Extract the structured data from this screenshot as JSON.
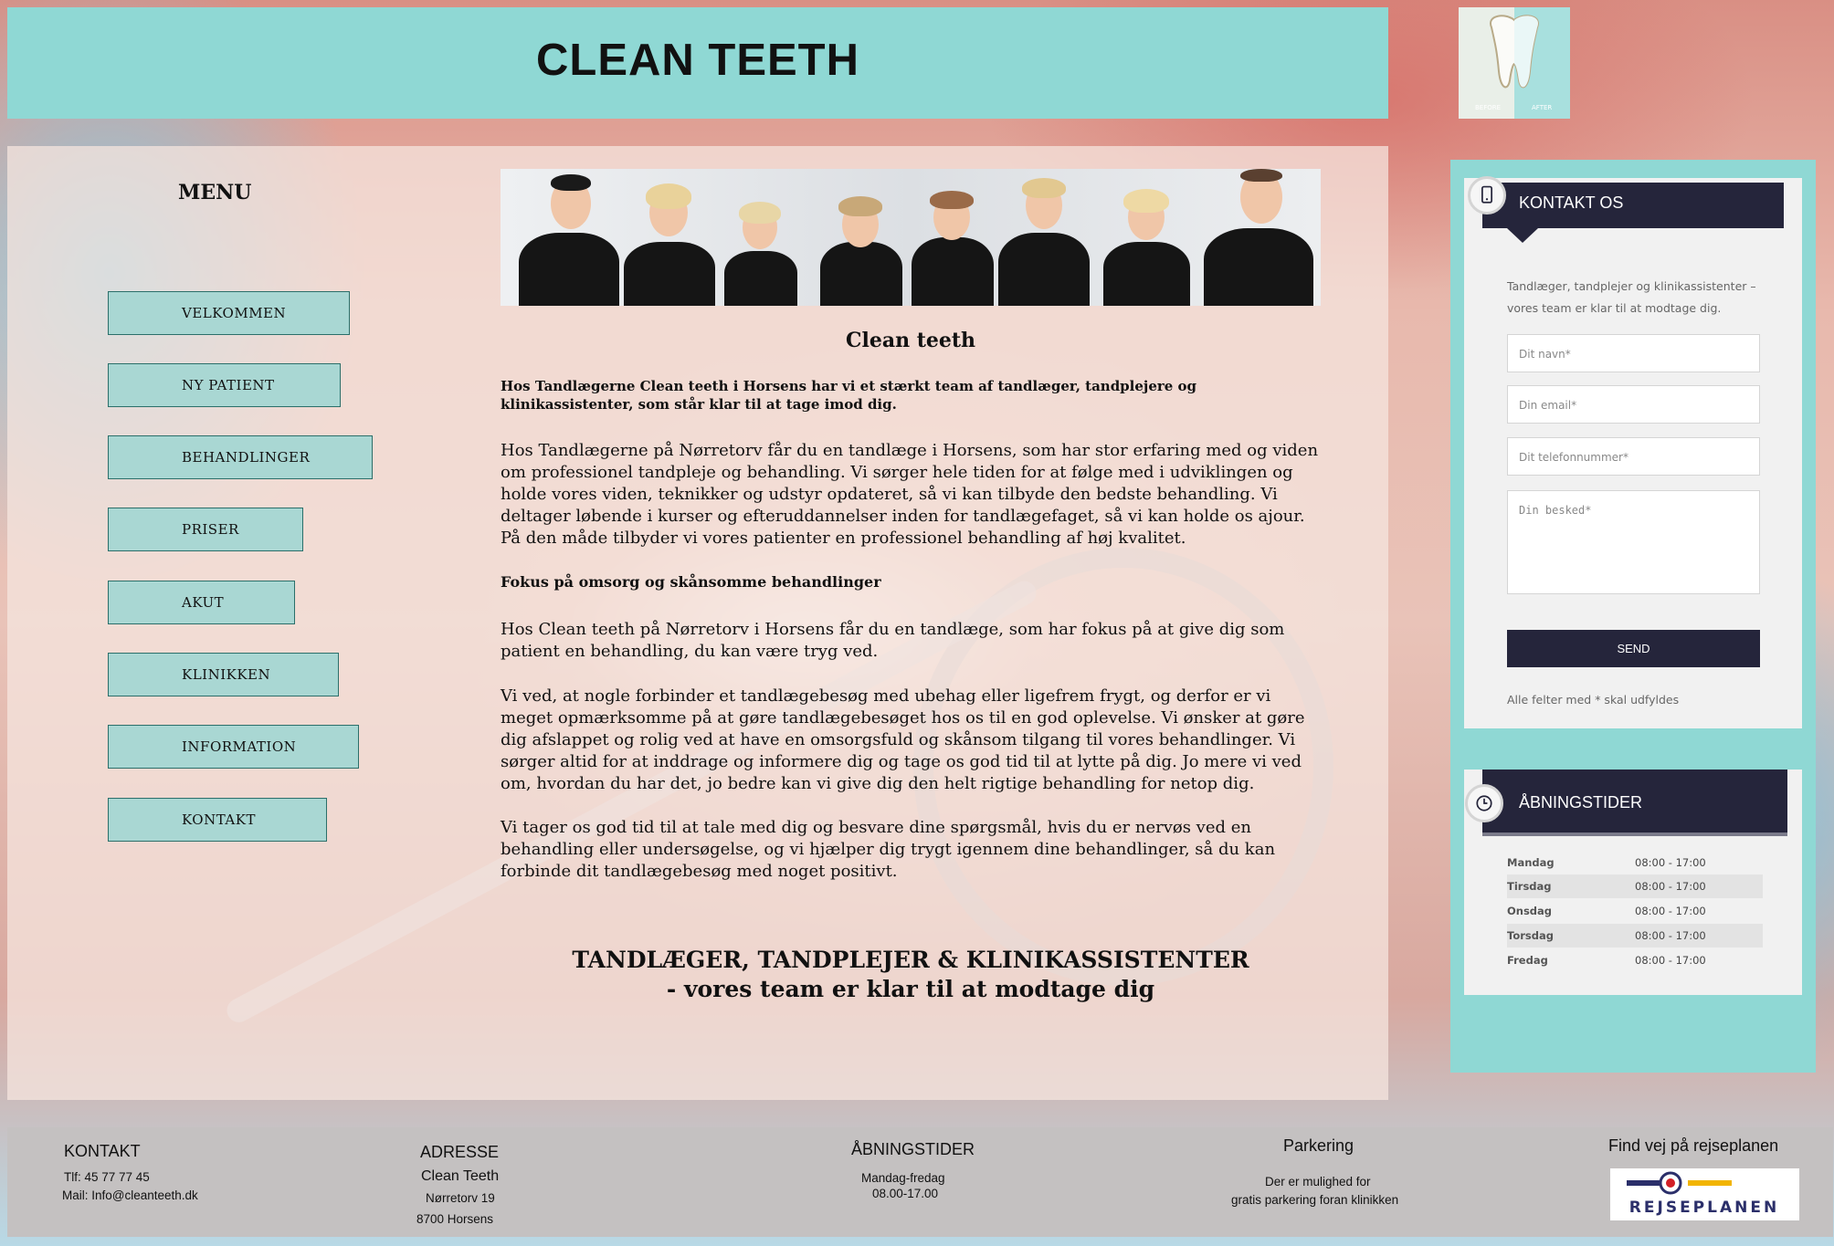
{
  "header": {
    "title": "CLEAN TEETH"
  },
  "logo": {
    "before": "BEFORE",
    "after": "AFTER"
  },
  "menu": {
    "title": "MENU",
    "items": [
      "VELKOMMEN",
      "NY PATIENT",
      "BEHANDLINGER",
      "PRISER",
      "AKUT",
      "KLINIKKEN",
      "INFORMATION",
      "KONTAKT"
    ]
  },
  "content": {
    "title": "Clean teeth",
    "intro": "Hos Tandlægerne Clean teeth i Horsens har vi et stærkt team af tandlæger, tandplejere og klinikassistenter, som står klar til at tage imod dig.",
    "p1": "Hos Tandlægerne på Nørretorv får du en tandlæge i Horsens, som har stor erfaring med og viden om professionel tandpleje og behandling. Vi sørger hele tiden for at følge med i udviklingen og holde vores viden, teknikker og udstyr opdateret, så vi kan tilbyde den bedste behandling. Vi deltager løbende i kurser og efteruddannelser inden for tandlægefaget, så vi kan holde os ajour. På den måde tilbyder vi vores patienter en professionel behandling af høj kvalitet.",
    "subheading": "Fokus på omsorg og skånsomme behandlinger",
    "p2": "Hos Clean teeth på Nørretorv i Horsens får du en tandlæge, som har fokus på at give dig som patient en behandling, du kan være tryg ved.",
    "p3": "Vi ved, at nogle forbinder et tandlægebesøg med ubehag eller ligefrem frygt, og derfor er vi meget opmærksomme på at gøre tandlægebesøget hos os til en god oplevelse. Vi ønsker at gøre dig afslappet og rolig ved at have en omsorgsfuld og skånsom tilgang til vores behandlinger. Vi sørger altid for at inddrage og informere dig og tage os god tid til at lytte på dig. Jo mere vi ved om, hvordan du har det, jo bedre kan vi give dig den helt rigtige behandling for netop dig.",
    "p4": "Vi tager os god tid til at tale med dig og besvare dine spørgsmål, hvis du er nervøs ved en behandling eller undersøgelse, og vi hjælper dig trygt igennem dine behandlinger, så du kan forbinde dit tandlægebesøg med noget positivt.",
    "tagline1": "TANDLÆGER, TANDPLEJER & KLINIKASSISTENTER",
    "tagline2": "- vores team er klar til at modtage dig"
  },
  "contact_widget": {
    "title": "KONTAKT OS",
    "description": "Tandlæger, tandplejer og klinikassistenter – vores team er klar til at modtage dig.",
    "name_placeholder": "Dit navn*",
    "email_placeholder": "Din email*",
    "phone_placeholder": "Dit telefonnummer*",
    "message_placeholder": "Din besked*",
    "send_label": "SEND",
    "required_note": "Alle felter med * skal udfyldes"
  },
  "hours_widget": {
    "title": "ÅBNINGSTIDER",
    "rows": [
      {
        "day": "Mandag",
        "time": "08:00 - 17:00"
      },
      {
        "day": "Tirsdag",
        "time": "08:00 - 17:00"
      },
      {
        "day": "Onsdag",
        "time": "08:00 - 17:00"
      },
      {
        "day": "Torsdag",
        "time": "08:00 - 17:00"
      },
      {
        "day": "Fredag",
        "time": "08:00 - 17:00"
      }
    ]
  },
  "footer": {
    "kontakt": {
      "title": "KONTAKT",
      "phone": "Tlf: 45 77 77 45",
      "mail": "Mail: Info@cleanteeth.dk"
    },
    "adresse": {
      "title": "ADRESSE",
      "name": "Clean Teeth",
      "street": "Nørretorv 19",
      "city": "8700 Horsens"
    },
    "aabning": {
      "title": "ÅBNINGSTIDER",
      "days": "Mandag-fredag",
      "time": "08.00-17.00"
    },
    "parkering": {
      "title": "Parkering",
      "line1": "Der er mulighed for",
      "line2": "gratis parkering foran klinikken"
    },
    "rejse": {
      "title": "Find vej på rejseplanen",
      "logo_text": "REJSEPLANEN"
    }
  },
  "colors": {
    "teal": "#8fd8d4",
    "menu_button": "#a9d7d3",
    "navy": "#25253b",
    "footer": "#c4c1c1"
  }
}
